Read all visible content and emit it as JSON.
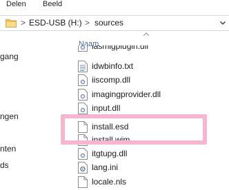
{
  "ribbon": {
    "tabs": [
      {
        "label": "Delen"
      },
      {
        "label": "Beeld"
      }
    ]
  },
  "address_bar": {
    "folder_icon": "folder-icon",
    "crumbs": [
      {
        "label": "ESD-USB (H:)"
      },
      {
        "label": "sources"
      }
    ],
    "separator": ">",
    "dropdown_icon": "chevron-down-icon"
  },
  "nav_pane": {
    "items": [
      {
        "label": "gang"
      },
      {
        "label": "ngen"
      },
      {
        "label": "nten"
      },
      {
        "label": "ds"
      }
    ]
  },
  "file_list": {
    "column_header": "Naam",
    "sort_icon": "chevron-up-icon",
    "files": [
      {
        "name": "lasmigplugin.dll",
        "type": "dll"
      },
      {
        "name": "idwbinfo.txt",
        "type": "txt"
      },
      {
        "name": "iiscomp.dll",
        "type": "dll"
      },
      {
        "name": "imagingprovider.dll",
        "type": "dll"
      },
      {
        "name": "input.dll",
        "type": "dll"
      },
      {
        "name": "install.esd",
        "type": "file"
      },
      {
        "name": "install.wim",
        "type": "file"
      },
      {
        "name": "itgtupg.dll",
        "type": "dll"
      },
      {
        "name": "lang.ini",
        "type": "ini"
      },
      {
        "name": "locale.nls",
        "type": "file"
      }
    ]
  },
  "highlight": {
    "color": "#f6b6cf"
  }
}
